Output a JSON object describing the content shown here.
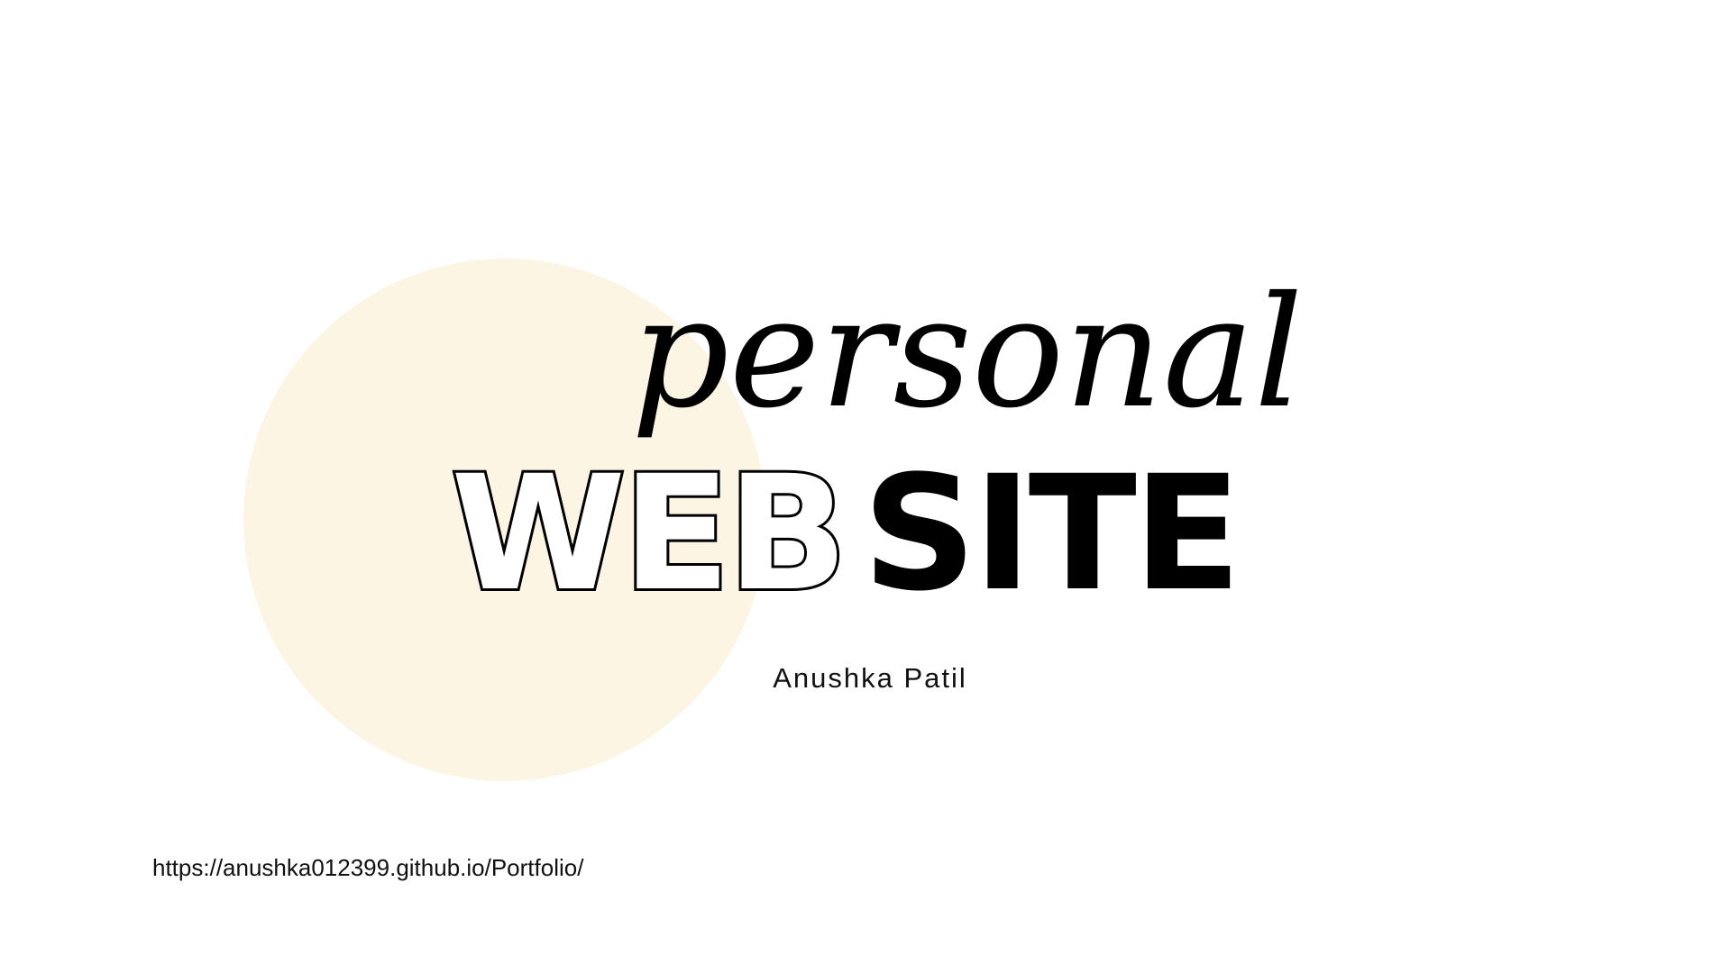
{
  "slide": {
    "script_word": "personal",
    "title_outline": "WEB",
    "title_solid": "SITE",
    "author": "Anushka Patil",
    "link": "https://anushka012399.github.io/Portfolio/"
  },
  "colors": {
    "background": "#ffffff",
    "circle": "#fdf5e3",
    "text": "#000000"
  }
}
